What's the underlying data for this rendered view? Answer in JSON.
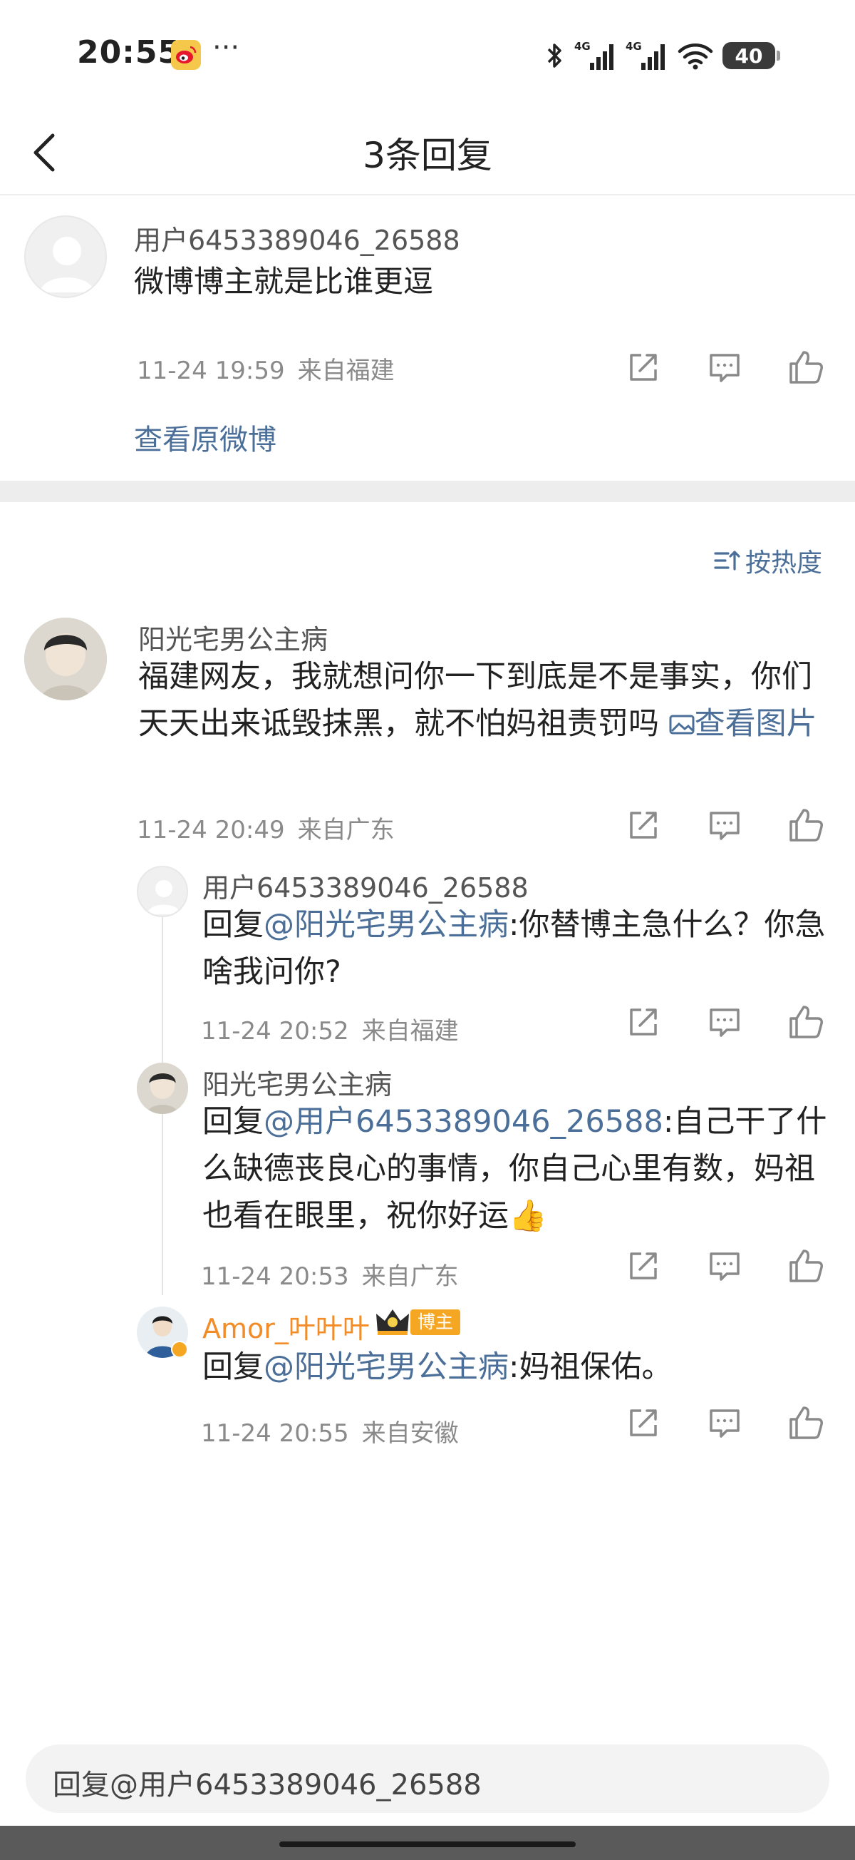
{
  "status_bar": {
    "time": "20:55",
    "app_icon": "weibo-icon",
    "more": "···",
    "battery": "40",
    "network_1": "4G",
    "network_2": "4G"
  },
  "nav": {
    "title": "3条回复",
    "back_icon": "chevron-left-icon"
  },
  "original_comment": {
    "username": "用户6453389046_26588",
    "text": "微博博主就是比谁更逗",
    "time": "11-24 19:59",
    "location": "来自福建",
    "view_original": "查看原微博"
  },
  "sort": {
    "label": "按热度",
    "icon": "sort-icon"
  },
  "main_comment": {
    "username": "阳光宅男公主病",
    "text": "福建网友，我就想问你一下到底是不是事实，你们天天出来诋毁抹黑，就不怕妈祖责罚吗",
    "image_link": "查看图片",
    "time": "11-24 20:49",
    "location": "来自广东"
  },
  "replies": [
    {
      "username": "用户6453389046_26588",
      "reply_prefix": "回复",
      "mention": "@阳光宅男公主病",
      "text": ":你替博主急什么？你急啥我问你?",
      "time": "11-24 20:52",
      "location": "来自福建"
    },
    {
      "username": "阳光宅男公主病",
      "reply_prefix": "回复",
      "mention": "@用户6453389046_26588",
      "text": ":自己干了什么缺德丧良心的事情，你自己心里有数，妈祖也看在眼里，祝你好运",
      "emoji": "👍",
      "time": "11-24 20:53",
      "location": "来自广东"
    },
    {
      "username": "Amor_叶叶叶",
      "badge": "博主",
      "reply_prefix": "回复",
      "mention": "@阳光宅男公主病",
      "text": ":妈祖保佑。",
      "time": "11-24 20:55",
      "location": "来自安徽"
    }
  ],
  "reply_box": {
    "placeholder": "回复@用户6453389046_26588"
  },
  "actions": {
    "share_icon": "share-icon",
    "comment_icon": "comment-icon",
    "like_icon": "thumbs-up-icon"
  },
  "colors": {
    "link": "#4b6f98",
    "author": "#f28c28",
    "divider": "#ededed"
  }
}
